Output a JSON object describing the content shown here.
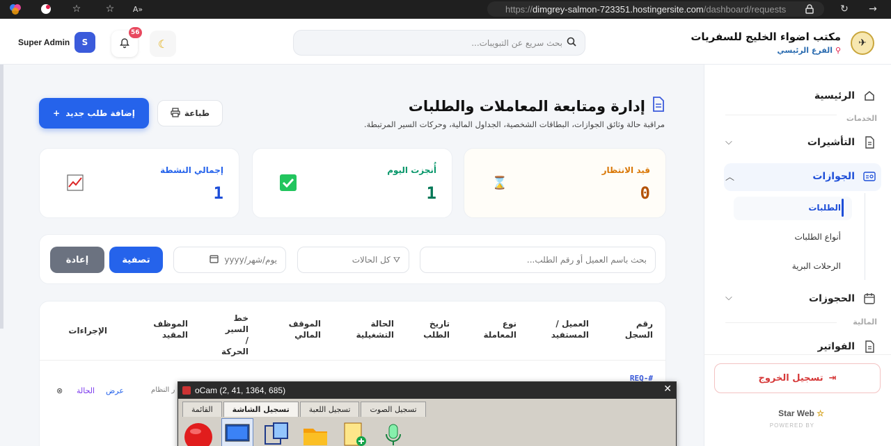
{
  "browser": {
    "url_prefix": "https://",
    "url_host": "dimgrey-salmon-723351.hostingersite.com",
    "url_path": "/dashboard/requests"
  },
  "header": {
    "admin_name": "Super Admin",
    "avatar_initial": "S",
    "notification_count": "56",
    "search_placeholder": "بحث سريع عن التبويبات...",
    "brand_title": "مكتب اضواء الخليج للسفريات",
    "brand_branch": "الفرع الرئيسي"
  },
  "sidebar": {
    "home": "الرئيسية",
    "section_services": "الخدمات",
    "visas": "التأشيرات",
    "passports": "الجوازات",
    "sub_requests": "الطلبات",
    "sub_request_types": "أنواع الطلبات",
    "sub_land_trips": "الرحلات البرية",
    "bookings": "الحجوزات",
    "section_finance": "المالية",
    "invoices": "الفواتير",
    "logout": "تسجيل الخروج",
    "footer_brand": "Star Web",
    "footer_powered": "POWERED BY"
  },
  "page": {
    "title": "إدارة ومتابعة المعاملات والطلبات",
    "subtitle": "مراقبة حالة وثائق الجوازات، البطاقات الشخصية، الجداول المالية، وحركات السير المرتبطة.",
    "add_button": "إضافة طلب جديد",
    "print_button": "طباعة"
  },
  "stats": [
    {
      "label": "قيد الانتظار",
      "value": "0",
      "color": "#d97706"
    },
    {
      "label": "أُنجزت اليوم",
      "value": "1",
      "color": "#059669"
    },
    {
      "label": "إجمالي النشطة",
      "value": "1",
      "color": "#2563eb"
    }
  ],
  "filters": {
    "search_placeholder": "بحث باسم العميل أو رقم الطلب...",
    "status_select": "كل الحالات",
    "date_placeholder": "يوم/شهر/yyyy",
    "filter_button": "تصفية",
    "reset_button": "إعادة"
  },
  "table": {
    "headers": [
      "رقم السجل",
      "العميل / المستفيد",
      "نوع المعاملة",
      "تاريخ الطلب",
      "الحالة التشغيلية",
      "الموقف المالي",
      "خط السير / الحركة",
      "الموظف المقيد",
      "الإجراءات"
    ],
    "row_id": "REQ-#",
    "row_employee": "ر النظام",
    "action_view": "عرض",
    "action_status": "الحالة"
  },
  "ocam": {
    "title": "oCam (2, 41, 1364, 685)",
    "tabs": [
      "القائمة",
      "تسجيل الشاشة",
      "تسجيل اللعبة",
      "تسجيل الصوت"
    ]
  }
}
